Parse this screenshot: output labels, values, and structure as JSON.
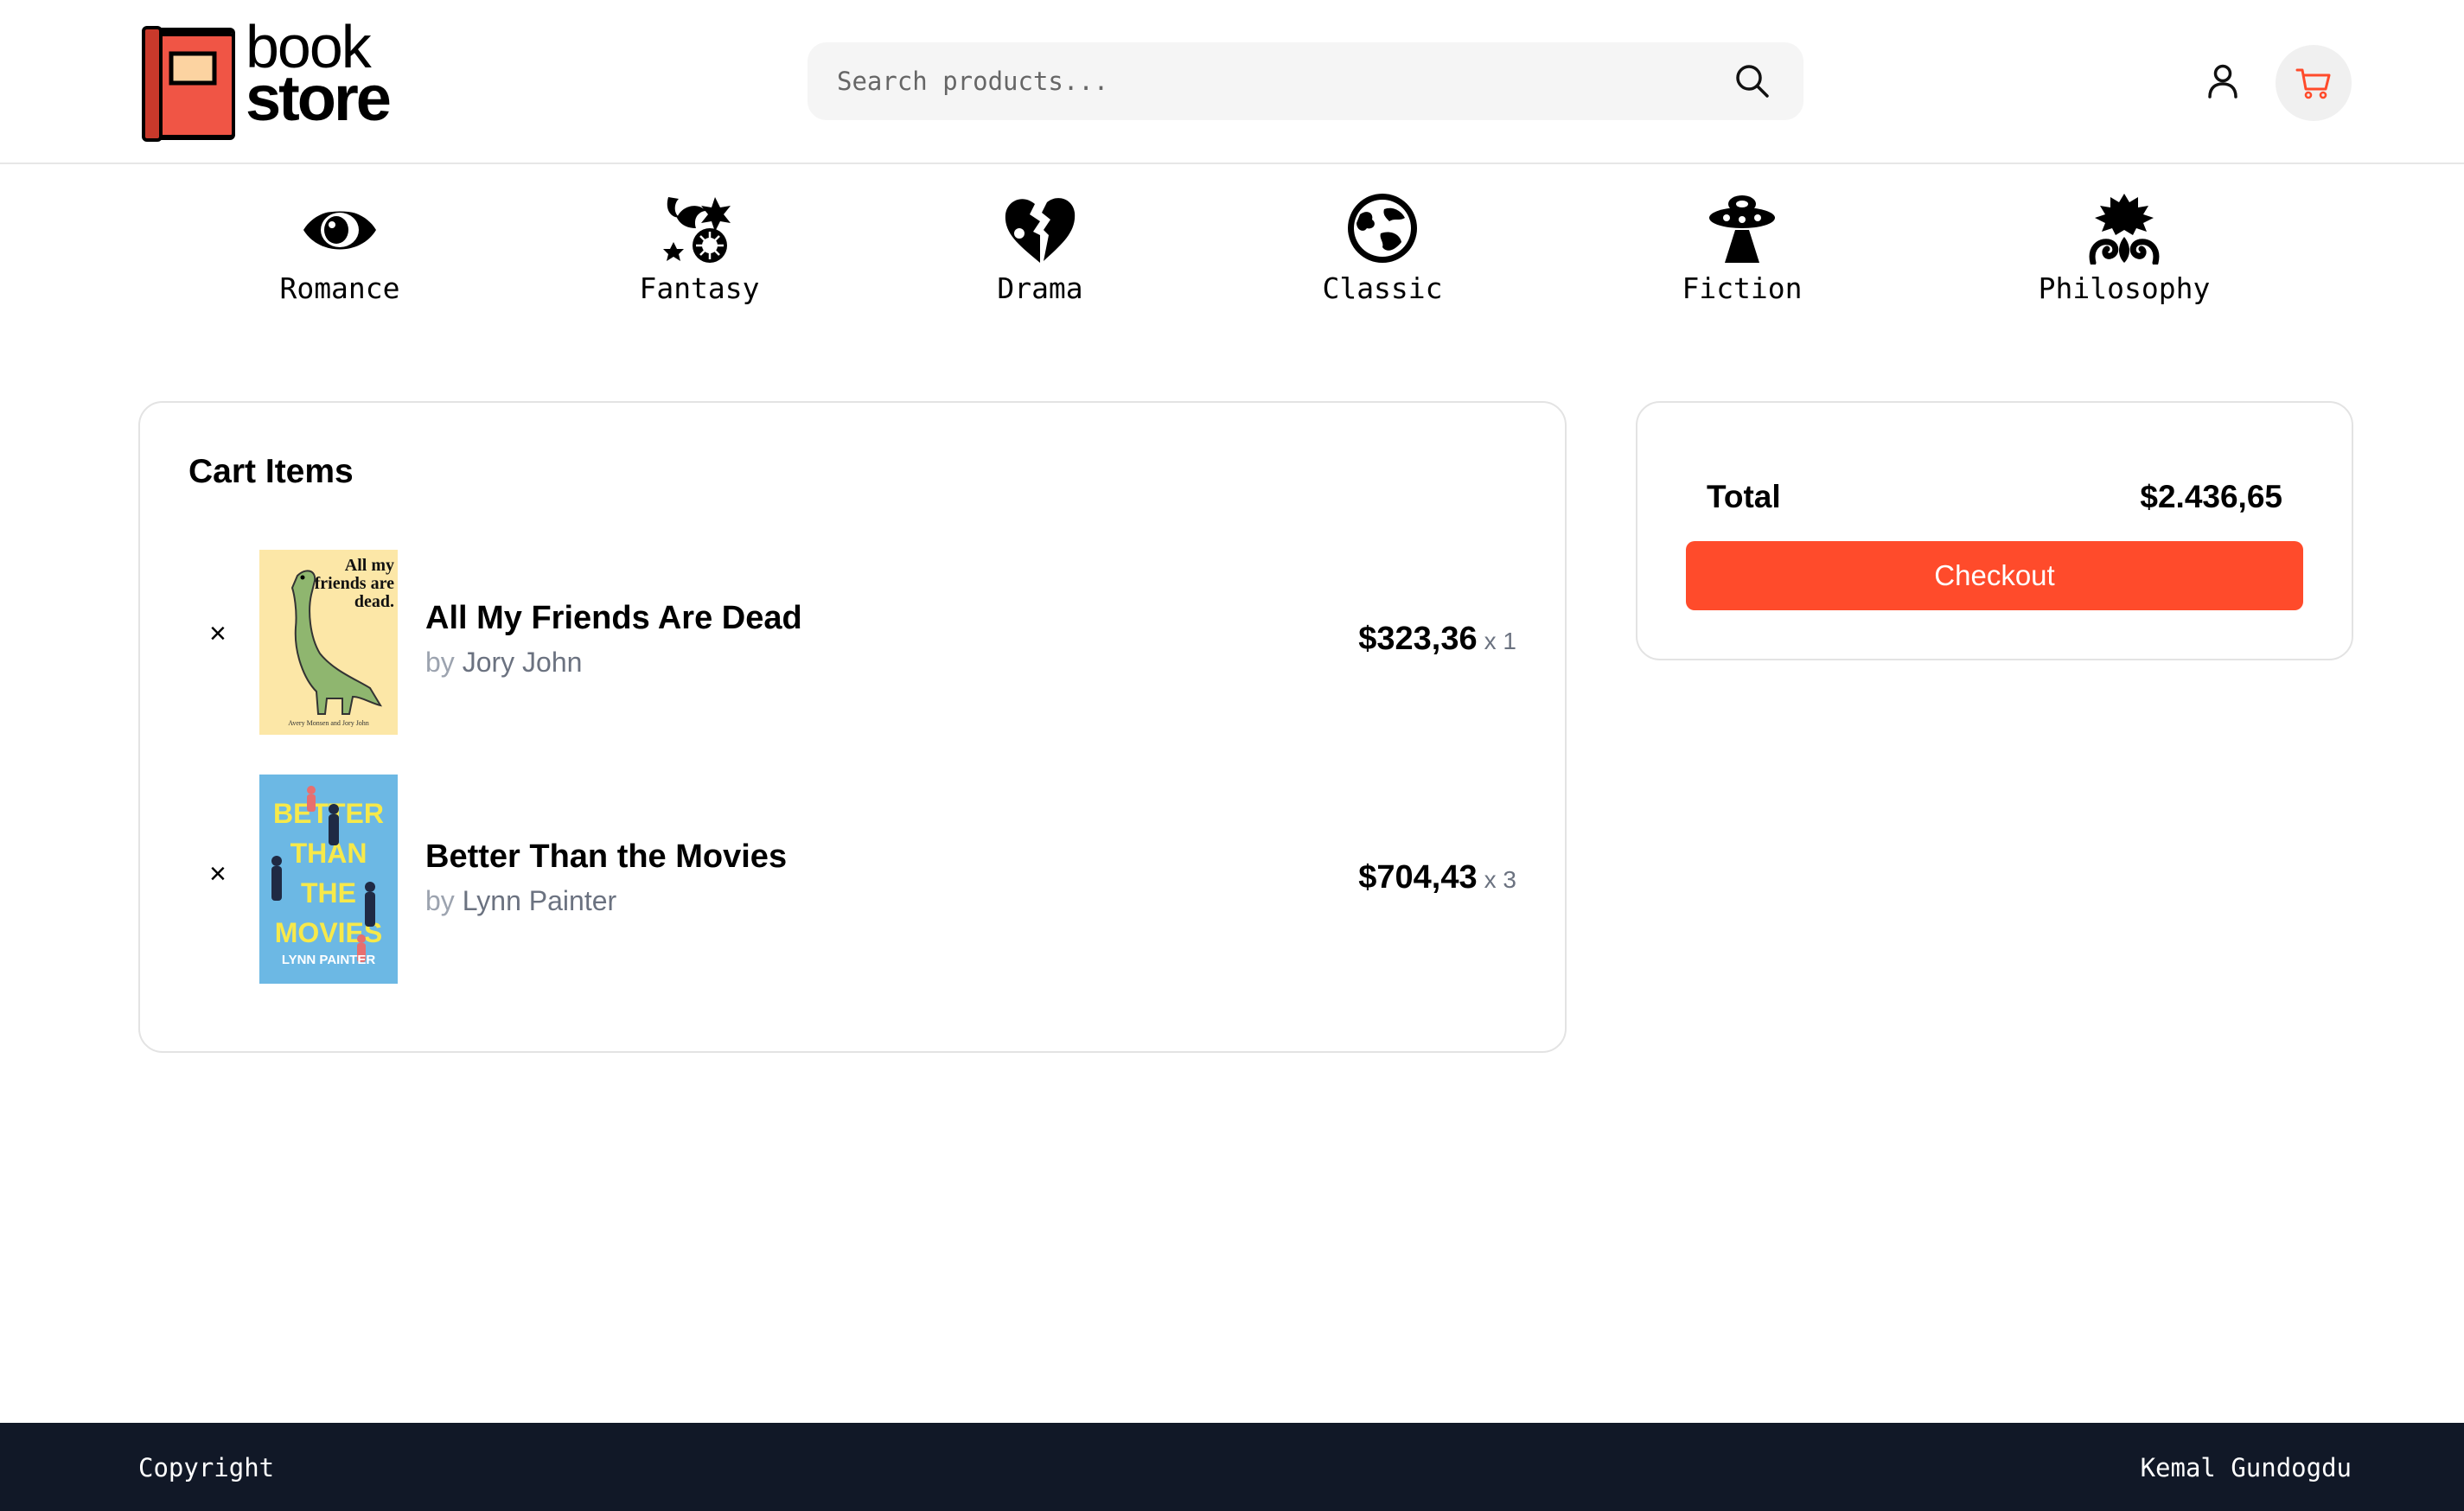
{
  "header": {
    "logo": {
      "line1": "book",
      "line2": "store"
    },
    "search": {
      "placeholder": "Search products..."
    },
    "icons": {
      "search": "search-icon",
      "user": "user-icon",
      "cart": "cart-icon"
    }
  },
  "categories": [
    {
      "label": "Romance",
      "icon": "eye-icon"
    },
    {
      "label": "Fantasy",
      "icon": "fantasy-icon"
    },
    {
      "label": "Drama",
      "icon": "broken-heart-icon"
    },
    {
      "label": "Classic",
      "icon": "globe-icon"
    },
    {
      "label": "Fiction",
      "icon": "ufo-icon"
    },
    {
      "label": "Philosophy",
      "icon": "philosophy-icon"
    }
  ],
  "cart": {
    "title": "Cart Items",
    "items": [
      {
        "title": "All My Friends Are Dead",
        "by": "by",
        "author": "Jory John",
        "price": "$323,36",
        "qty": "x 1",
        "remove": "×",
        "cover": {
          "text": "All my friends are dead.",
          "credit": "Avery Monsen and Jory John",
          "bg": "#fce7a7"
        }
      },
      {
        "title": "Better Than the Movies",
        "by": "by",
        "author": "Lynn Painter",
        "price": "$704,43",
        "qty": "x 3",
        "remove": "×",
        "cover": {
          "line1": "BETTER",
          "line2": "THAN",
          "line3": "THE",
          "line4": "MOVIES",
          "author": "LYNN PAINTER",
          "bg": "#6cb8e4"
        }
      }
    ]
  },
  "summary": {
    "total_label": "Total",
    "total_value": "$2.436,65",
    "checkout_label": "Checkout"
  },
  "footer": {
    "left": "Copyright",
    "right": "Kemal Gundogdu"
  },
  "colors": {
    "accent": "#ff4b2b",
    "footer_bg": "#111827",
    "logo_red": "#f05545",
    "muted": "#6b7280"
  }
}
